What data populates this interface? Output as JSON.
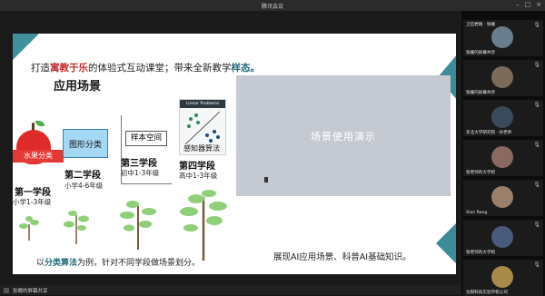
{
  "window": {
    "title": "腾讯会议"
  },
  "slide": {
    "header_prefix": "打造",
    "header_red": "寓教于乐",
    "header_mid": "的体验式互动课堂；带来全新教学",
    "header_teal": "样态。",
    "section_title": "应用场景",
    "apple_label": "水果分类",
    "graph_label": "图形分类",
    "sample_label": "样本空间",
    "perceptron_header": "Linear Problems",
    "perceptron_label": "感知器算法",
    "stages": [
      {
        "name": "第一学段",
        "grade": "小学1-3年级"
      },
      {
        "name": "第二学段",
        "grade": "小学4-6年级"
      },
      {
        "name": "第三学段",
        "grade": "初中1-3年级"
      },
      {
        "name": "第四学段",
        "grade": "高中1-3年级"
      }
    ],
    "video_text": "场景使用演示",
    "bottom_left_prefix": "以",
    "bottom_left_bold": "分类算法",
    "bottom_left_suffix": "为例，针对不同学段做场景划分。",
    "bottom_right": "展现AI应用场景、科普AI基础知识。"
  },
  "status_bar": {
    "sharer": "张姗的屏幕共享"
  },
  "participants": [
    {
      "name": "张姗的屏幕共享",
      "color": "#6a7d8c",
      "label_top": "卫哲岩端 · 张姗"
    },
    {
      "name": "张姗的屏幕共享",
      "color": "#7c6a5a"
    },
    {
      "name": "东北大学研究院 · 孙老师",
      "color": "#3a4a5a"
    },
    {
      "name": "张老师的大学校",
      "color": "#8a6a60"
    },
    {
      "name": "Xian Rong",
      "color": "#9a7f6a"
    },
    {
      "name": "张老师的大学校",
      "color": "#4a5a7a"
    },
    {
      "name": "沈阳科技实验学校公司",
      "color": "#a88a4a"
    }
  ]
}
